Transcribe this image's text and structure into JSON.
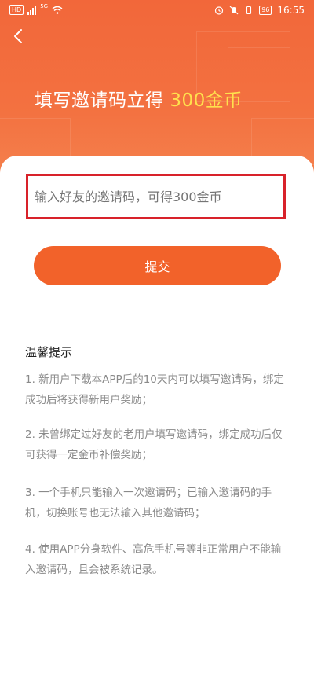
{
  "status_bar": {
    "hd": "HD",
    "network": "5G",
    "battery": "96",
    "time": "16:55"
  },
  "header": {
    "title_prefix": "填写邀请码立得 ",
    "title_highlight": "300金币"
  },
  "invite_input": {
    "placeholder": "输入好友的邀请码，可得300金币",
    "value": ""
  },
  "submit_label": "提交",
  "tips": {
    "title": "温馨提示",
    "items": [
      "1. 新用户下载本APP后的10天内可以填写邀请码，绑定成功后将获得新用户奖励；",
      "2. 未曾绑定过好友的老用户填写邀请码，绑定成功后仅可获得一定金币补偿奖励；",
      "3. 一个手机只能输入一次邀请码；已输入邀请码的手机，切换账号也无法输入其他邀请码；",
      "4. 使用APP分身软件、高危手机号等非正常用户不能输入邀请码，且会被系统记录。"
    ]
  },
  "colors": {
    "hero": "#f2673a",
    "highlight": "#ffe14d",
    "button": "#f2622a",
    "input_border": "#d8222a"
  }
}
